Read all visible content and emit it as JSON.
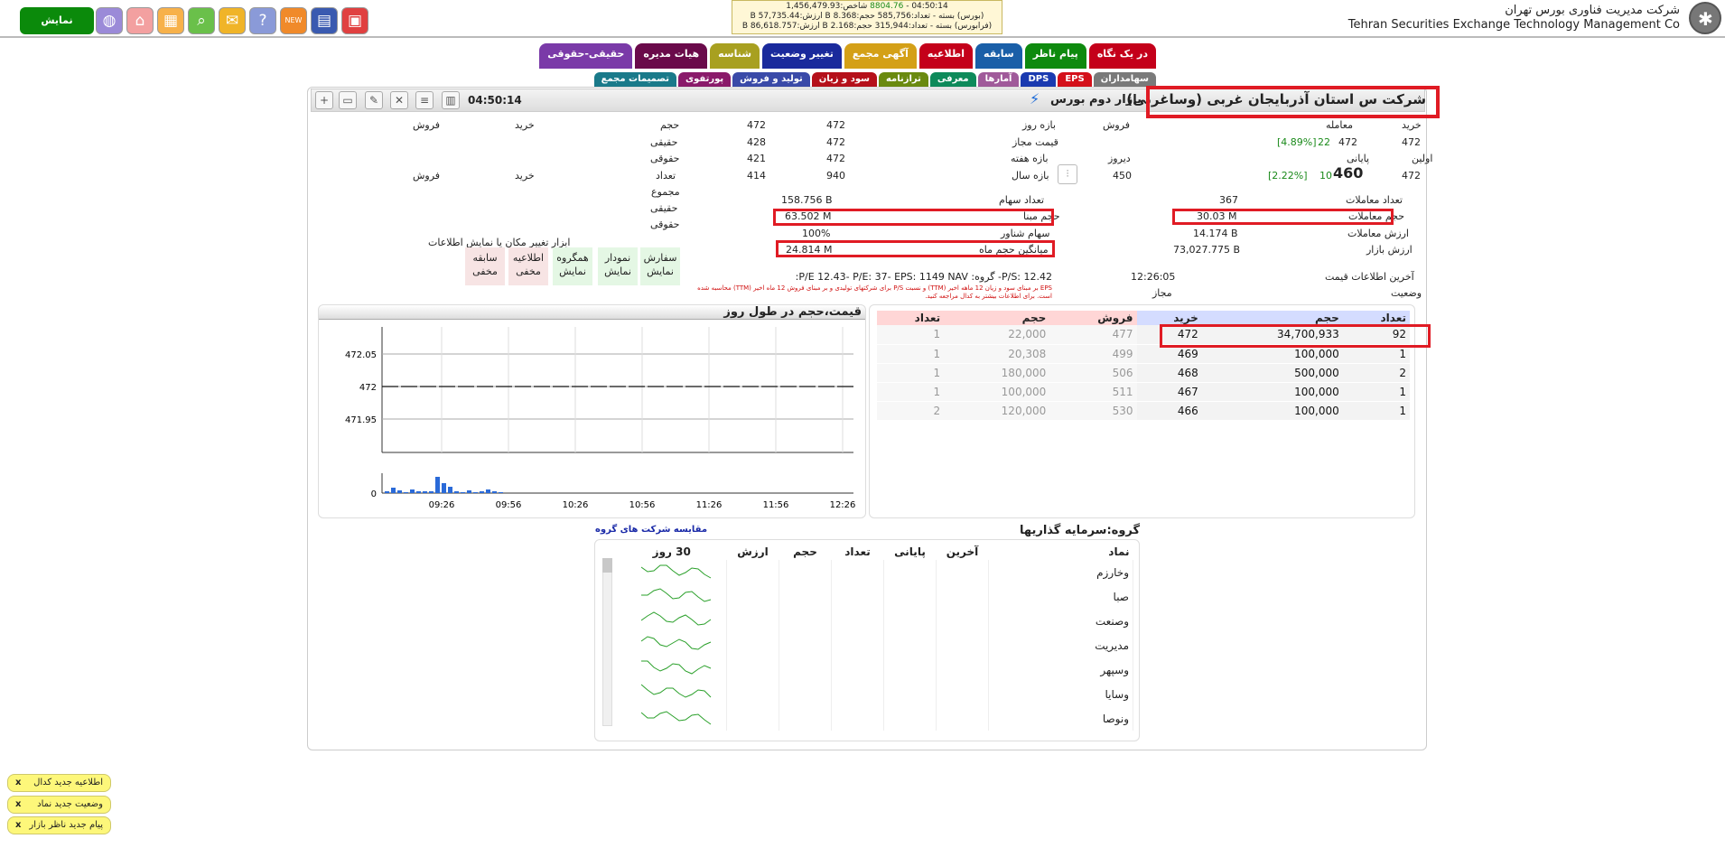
{
  "header": {
    "company_fa": "شرکت مدیریت فناوری بورس تهران",
    "company_en": "Tehran Securities Exchange Technology Management Co",
    "show_list": "نمایش فهرست",
    "ticker": {
      "line1_time": "04:50:14 - ",
      "line1_green": "8804.76",
      "line1_rest": " شاخص:1,456,479.93",
      "line2": "(بورس) بسته - تعداد:585,756 حجم:8.368 B ارزش:57,735.44 B",
      "line3": "(فرابورس) بسته - تعداد:315,944 حجم:2.168 B ارزش:86,618.757 B"
    }
  },
  "tabs_row1": [
    "در یک نگاه",
    "پیام ناظر",
    "سابقه",
    "اطلاعیه",
    "آگهی مجمع",
    "تغییر وضعیت",
    "شناسه",
    "هیات مدیره",
    "حقیقی-حقوقی"
  ],
  "tabs_row2": [
    "سهامداران",
    "EPS",
    "DPS",
    "آمارها",
    "معرفی",
    "ترازنامه",
    "سود و زیان",
    "تولید و فروش",
    "پورتفوی",
    "تصمیمات مجمع"
  ],
  "tab_colors_row1": [
    "#c4001a",
    "#0e8a0e",
    "#1a5fa8",
    "#c4001a",
    "#d4a017",
    "#1a2a9c",
    "#a8a020",
    "#6a0a4a",
    "#7a3aa8"
  ],
  "tab_colors_row2": [
    "#7a7a7a",
    "#d4101a",
    "#1a3ab0",
    "#a05a9a",
    "#0e8a5a",
    "#6a8a10",
    "#b5101a",
    "#3a4aa8",
    "#8a1a6a",
    "#1a7a8a"
  ],
  "symbol": {
    "title": "شرکت س استان آذربایجان غربی (وساغربی)",
    "market": "بازار دوم بورس",
    "time": "04:50:14"
  },
  "price": {
    "buy_label": "خرید",
    "trade_label": "معامله",
    "sell_label": "فروش",
    "buy": "472",
    "trade": "472",
    "trade_change": "22",
    "trade_pct": "[4.89%]",
    "first_label": "اولین",
    "final_label": "پایانی",
    "yesterday_label": "دیروز",
    "first": "472",
    "final": "460",
    "final_change": "10",
    "final_pct": "[2.22%]",
    "yesterday": "450"
  },
  "ranges": [
    {
      "label": "بازه روز",
      "a": "472",
      "b": "472"
    },
    {
      "label": "قیمت مجاز",
      "a": "472",
      "b": "428"
    },
    {
      "label": "بازه هفته",
      "a": "472",
      "b": "421"
    },
    {
      "label": "بازه سال",
      "a": "940",
      "b": "414"
    }
  ],
  "stats_left": [
    {
      "label": "تعداد معاملات",
      "value": "367"
    },
    {
      "label": "حجم معاملات",
      "value": "30.03 M"
    },
    {
      "label": "ارزش معاملات",
      "value": "14.174 B"
    },
    {
      "label": "ارزش بازار",
      "value": "73,027.775 B"
    }
  ],
  "stats_mid": [
    {
      "label": "تعداد سهام",
      "value": "158.756 B"
    },
    {
      "label": "حجم مبنا",
      "value": "63.502 M"
    },
    {
      "label": "سهام شناور",
      "value": "100%"
    },
    {
      "label": "میانگین حجم ماه",
      "value": "24.814 M"
    }
  ],
  "last_info": {
    "label": "آخرین اطلاعات قیمت",
    "time": "12:26:05",
    "status_label": "وضعیت",
    "status": "مجاز"
  },
  "ratios": "P/S:   12.42-   گروه: P/E   12.43-   P/E:   37-   EPS:   1149   NAV:",
  "ratios_note": "EPS بر مبنای سود و زیان 12 ماهه اخیر (TTM) و نسبت P/S برای شرکتهای تولیدی و بر مبنای فروش 12 ماه اخیر (TTM) محاسبه شده است. برای اطلاعات بیشتر به کدال مراجعه کنید.",
  "real_legal": {
    "vol_label": "حجم",
    "buy": "خرید",
    "sell": "فروش",
    "real": "حقیقی",
    "legal": "حقوقی",
    "count_label": "تعداد",
    "total": "مجموع"
  },
  "tools": {
    "title": "ابزار تغییر مکان یا نمایش اطلاعات",
    "buttons": [
      {
        "name": "سفارش",
        "state": "نمایش"
      },
      {
        "name": "نمودار",
        "state": "نمایش"
      },
      {
        "name": "همگروه",
        "state": "نمایش"
      },
      {
        "name": "اطلاعیه",
        "state": "مخفی"
      },
      {
        "name": "سابقه",
        "state": "مخفی"
      }
    ]
  },
  "orderbook": {
    "headers": [
      "تعداد",
      "حجم",
      "خرید",
      "فروش",
      "حجم",
      "تعداد"
    ],
    "rows": [
      {
        "bc": "92",
        "bv": "34,700,933",
        "bp": "472",
        "sp": "477",
        "sv": "22,000",
        "sc": "1"
      },
      {
        "bc": "1",
        "bv": "100,000",
        "bp": "469",
        "sp": "499",
        "sv": "20,308",
        "sc": "1"
      },
      {
        "bc": "2",
        "bv": "500,000",
        "bp": "468",
        "sp": "506",
        "sv": "180,000",
        "sc": "1"
      },
      {
        "bc": "1",
        "bv": "100,000",
        "bp": "467",
        "sp": "511",
        "sv": "100,000",
        "sc": "1"
      },
      {
        "bc": "1",
        "bv": "100,000",
        "bp": "466",
        "sp": "530",
        "sv": "120,000",
        "sc": "2"
      }
    ]
  },
  "intraday": {
    "title": "قیمت،حجم در طول روز",
    "yticks": [
      "472.05",
      "472",
      "471.95"
    ],
    "vol_tick": "0",
    "xticks": [
      "09:26",
      "09:56",
      "10:26",
      "10:56",
      "11:26",
      "11:56",
      "12:26"
    ]
  },
  "chart_data": {
    "type": "line",
    "title": "قیمت،حجم در طول روز",
    "x": [
      "09:26",
      "09:56",
      "10:26",
      "10:56",
      "11:26",
      "11:56",
      "12:26"
    ],
    "series": [
      {
        "values": [
          472,
          472,
          472,
          472,
          472,
          472,
          472
        ]
      }
    ],
    "volume": [
      0.1,
      0.3,
      0.15,
      0.05,
      0.2,
      0.08,
      0.12,
      0.1,
      0.9,
      0.55,
      0.35,
      0.1,
      0.05,
      0.15,
      0.05,
      0.08,
      0.2,
      0.1,
      0.05
    ],
    "ylim": [
      471.9,
      472.1
    ]
  },
  "group": {
    "title": "گروه:سرمایه گذاریها",
    "compare": "مقایسه شرکت های گروه",
    "headers": [
      "نماد",
      "آخرین",
      "پایانی",
      "تعداد",
      "حجم",
      "ارزش",
      "30 روز"
    ],
    "symbols": [
      "وخارزم",
      "صبا",
      "وصنعت",
      "مدیریت",
      "وسپهر",
      "وسایا",
      "ونوصا"
    ]
  },
  "notices": [
    {
      "text": "اطلاعیه جدید کدال",
      "close": "x"
    },
    {
      "text": "وضعیت جدید نماد",
      "close": "x"
    },
    {
      "text": "پیام جدید ناظر بازار",
      "close": "x"
    }
  ]
}
